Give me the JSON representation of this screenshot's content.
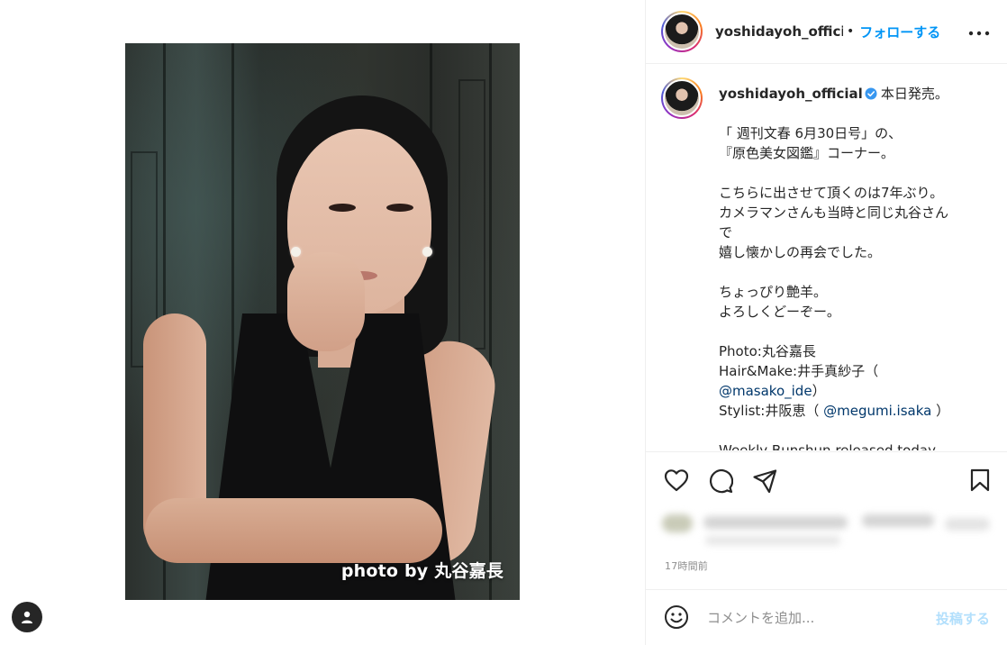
{
  "post": {
    "username": "yoshidayoh_official",
    "header_username": "yoshidayoh_officia",
    "separator": "•",
    "follow_label": "フォローする",
    "more_label": "•••",
    "photo_credit": "photo by 丸谷嘉長",
    "verified": true
  },
  "caption": {
    "first_line": "本日発売。",
    "lines": [
      "",
      "「 週刊文春 6月30日号」の、",
      "『原色美女図鑑』コーナー。",
      "",
      "こちらに出させて頂くのは7年ぶり。",
      "カメラマンさんも当時と同じ丸谷さん",
      "で",
      "嬉し懐かしの再会でした。",
      "",
      "ちょっぴり艶羊。",
      "よろしくどーぞー。",
      "",
      "Photo:丸谷嘉長"
    ],
    "hair_prefix": "Hair&Make:井手真紗子（",
    "hair_mention": "@masako_ide",
    "hair_suffix": "）",
    "stylist_prefix": "Stylist:井阪恵（ ",
    "stylist_mention": "@megumi.isaka",
    "stylist_suffix": " ）",
    "blank_after": "",
    "last_line": "Weekly Bunshun released today."
  },
  "meta": {
    "timestamp": "17時間前"
  },
  "comment_box": {
    "placeholder": "コメントを追加...",
    "post_label": "投稿する"
  },
  "icons": {
    "like": "heart-icon",
    "comment": "comment-icon",
    "share": "paper-plane-icon",
    "save": "bookmark-icon",
    "emoji": "smiley-icon",
    "tag": "user-tag-icon",
    "verified": "verified-badge-icon"
  },
  "colors": {
    "accent": "#0095f6",
    "mention": "#00376b",
    "post_disabled": "#b2dffc",
    "muted": "#8e8e8e"
  }
}
